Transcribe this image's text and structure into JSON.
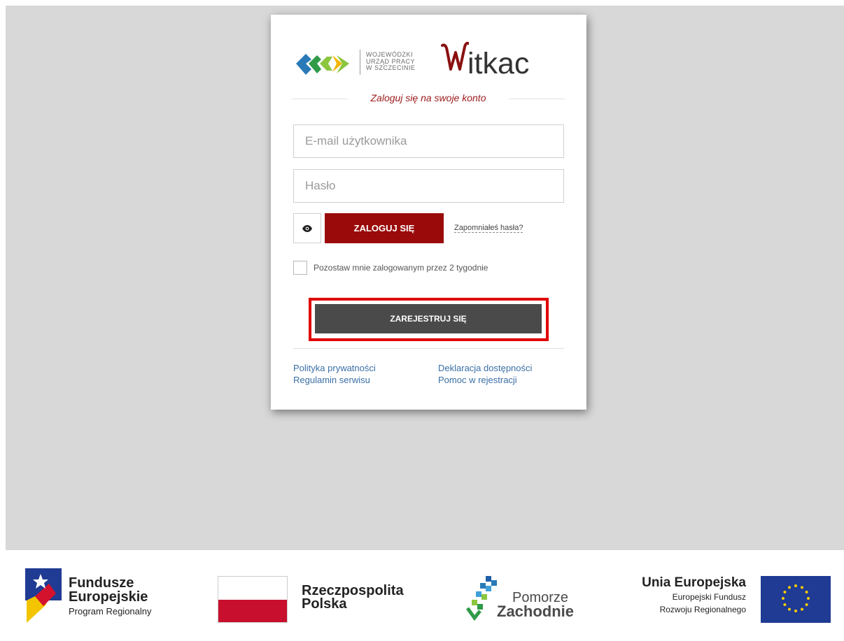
{
  "logos": {
    "wup_lines": [
      "WOJEWÓDZKI",
      "URZĄD PRACY",
      "W SZCZECINIE"
    ],
    "witkac_tail": "itkac"
  },
  "login": {
    "heading": "Zaloguj się na swoje konto",
    "email_placeholder": "E-mail użytkownika",
    "password_placeholder": "Hasło",
    "login_button": "ZALOGUJ SIĘ",
    "forgot_link": "Zapomniałeś hasła?",
    "remember_label": "Pozostaw mnie zalogowanym przez 2 tygodnie",
    "register_button": "ZAREJESTRUJ SIĘ"
  },
  "links": {
    "privacy": "Polityka prywatności",
    "terms": "Regulamin serwisu",
    "accessibility": "Deklaracja dostępności",
    "help": "Pomoc w rejestracji"
  },
  "footer": {
    "fe_line1": "Fundusze",
    "fe_line2": "Europejskie",
    "fe_line3": "Program Regionalny",
    "rp_line1": "Rzeczpospolita",
    "rp_line2": "Polska",
    "pz_line1": "Pomorze",
    "pz_line2": "Zachodnie",
    "ue_line1": "Unia Europejska",
    "ue_line2": "Europejski Fundusz",
    "ue_line3": "Rozwoju Regionalnego"
  },
  "colors": {
    "accent_red": "#9a0a0a",
    "register_gray": "#4a4a4a",
    "highlight_red": "#e00000",
    "link_blue": "#3a6fa5"
  }
}
